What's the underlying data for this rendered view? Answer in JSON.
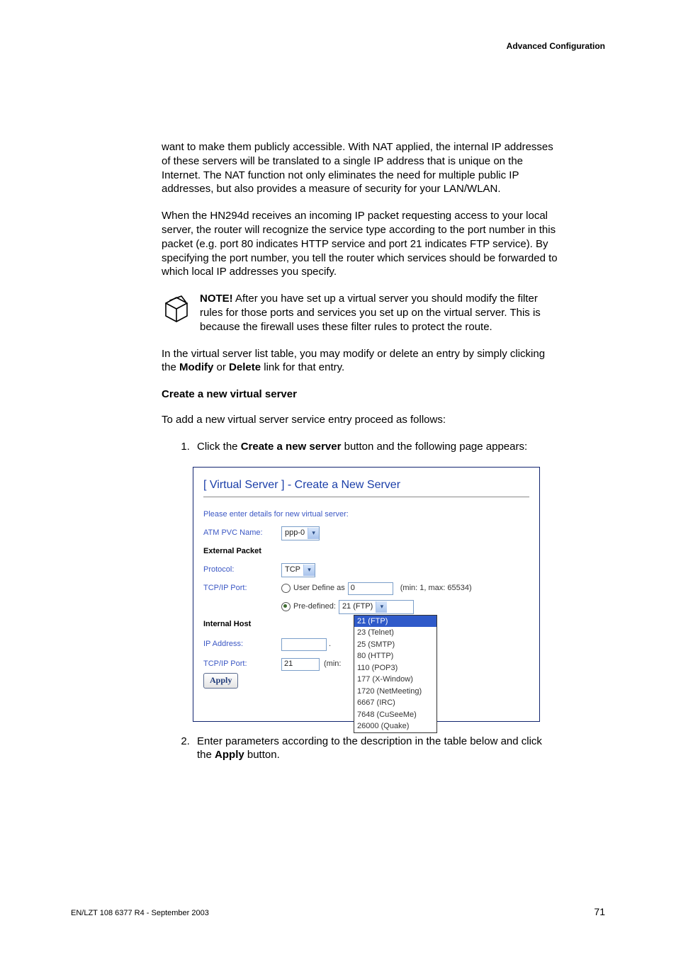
{
  "header": {
    "section": "Advanced Configuration"
  },
  "body": {
    "p1": "want to make them publicly accessible. With NAT applied, the internal IP addresses of these servers will be translated to a single IP address that is unique on the Internet. The NAT function not only eliminates the need for multiple public IP addresses, but also provides a measure of security for your LAN/WLAN.",
    "p2": "When the HN294d receives an incoming IP packet requesting access to your local server, the router will recognize the service type according to the port number in this packet (e.g. port 80 indicates HTTP service and port 21 indicates FTP service). By specifying the port number, you tell the router which services should be forwarded to which local IP addresses you specify.",
    "note_bold": "NOTE!",
    "note_rest": " After you have set up a virtual server you should modify the filter rules for those ports and services you set up on the virtual server. This is because the firewall uses these filter rules to protect the route.",
    "p3a": "In the virtual server list table, you may modify or delete an entry by simply clicking the ",
    "p3_mod": "Modify",
    "p3_or": " or ",
    "p3_del": "Delete",
    "p3b": " link for that entry.",
    "h_create": "Create a new virtual server",
    "p4": "To add a new virtual server service entry proceed as follows:",
    "li1a": "Click the ",
    "li1_bold": "Create a new server",
    "li1b": " button and the following page appears:",
    "li2a": "Enter parameters according to the description in the table below and click the ",
    "li2_bold": "Apply",
    "li2b": " button."
  },
  "shot": {
    "title": "[ Virtual Server ] - Create a New Server",
    "intro": "Please enter details for new virtual server:",
    "row_atm": "ATM PVC Name:",
    "atm_value": "ppp-0",
    "h_external": "External Packet",
    "row_proto": "Protocol:",
    "proto_value": "TCP",
    "row_tcpip": "TCP/IP Port:",
    "userdef_label": "User Define as",
    "userdef_value": "0",
    "range_hint": "(min: 1, max: 65534)",
    "predef_label": "Pre-defined:",
    "predef_value": "21 (FTP)",
    "h_internal": "Internal Host",
    "row_ipaddr": "IP Address:",
    "ip_dot": ".",
    "row_tcpip2": "TCP/IP Port:",
    "port2_value": "21",
    "min_hint": "(min:",
    "apply": "Apply",
    "options": [
      "21 (FTP)",
      "23 (Telnet)",
      "25 (SMTP)",
      "80 (HTTP)",
      "110 (POP3)",
      "177 (X-Window)",
      "1720 (NetMeeting)",
      "6667 (IRC)",
      "7648 (CuSeeMe)",
      "26000 (Quake)"
    ]
  },
  "footer": {
    "left": "EN/LZT 108 6377 R4 - September 2003",
    "page": "71"
  }
}
